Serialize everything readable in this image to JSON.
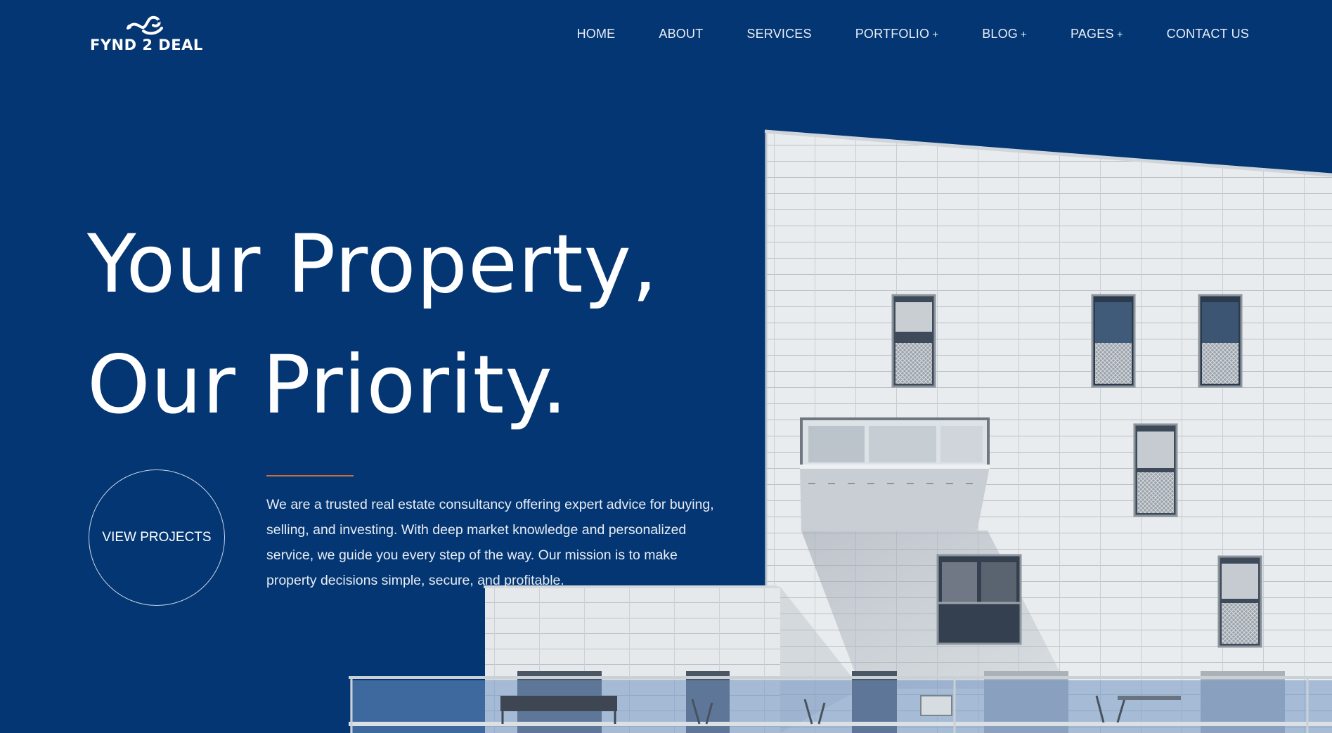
{
  "brand": {
    "logo_text": "FYND 2 DEAL"
  },
  "nav": {
    "items": [
      {
        "label": "HOME",
        "has_submenu": false
      },
      {
        "label": "ABOUT",
        "has_submenu": false
      },
      {
        "label": "SERVICES",
        "has_submenu": false
      },
      {
        "label": "PORTFOLIO",
        "has_submenu": true
      },
      {
        "label": "BLOG",
        "has_submenu": true
      },
      {
        "label": "PAGES",
        "has_submenu": true
      },
      {
        "label": "CONTACT US",
        "has_submenu": false
      }
    ],
    "submenu_marker": "+"
  },
  "hero": {
    "title_line1": "Your Property,",
    "title_line2": "Our Priority.",
    "cta_label": "VIEW PROJECTS",
    "description": "We are a trusted real estate consultancy offering expert advice for buying, selling, and investing. With deep market knowledge and personalized service, we guide you every step of the way. Our mission is to make property decisions simple, secure, and profitable."
  },
  "colors": {
    "background": "#033672",
    "accent": "#d06a3c",
    "text": "#ffffff"
  },
  "icons": {
    "logo_mark": "stylized-bird-mark"
  }
}
